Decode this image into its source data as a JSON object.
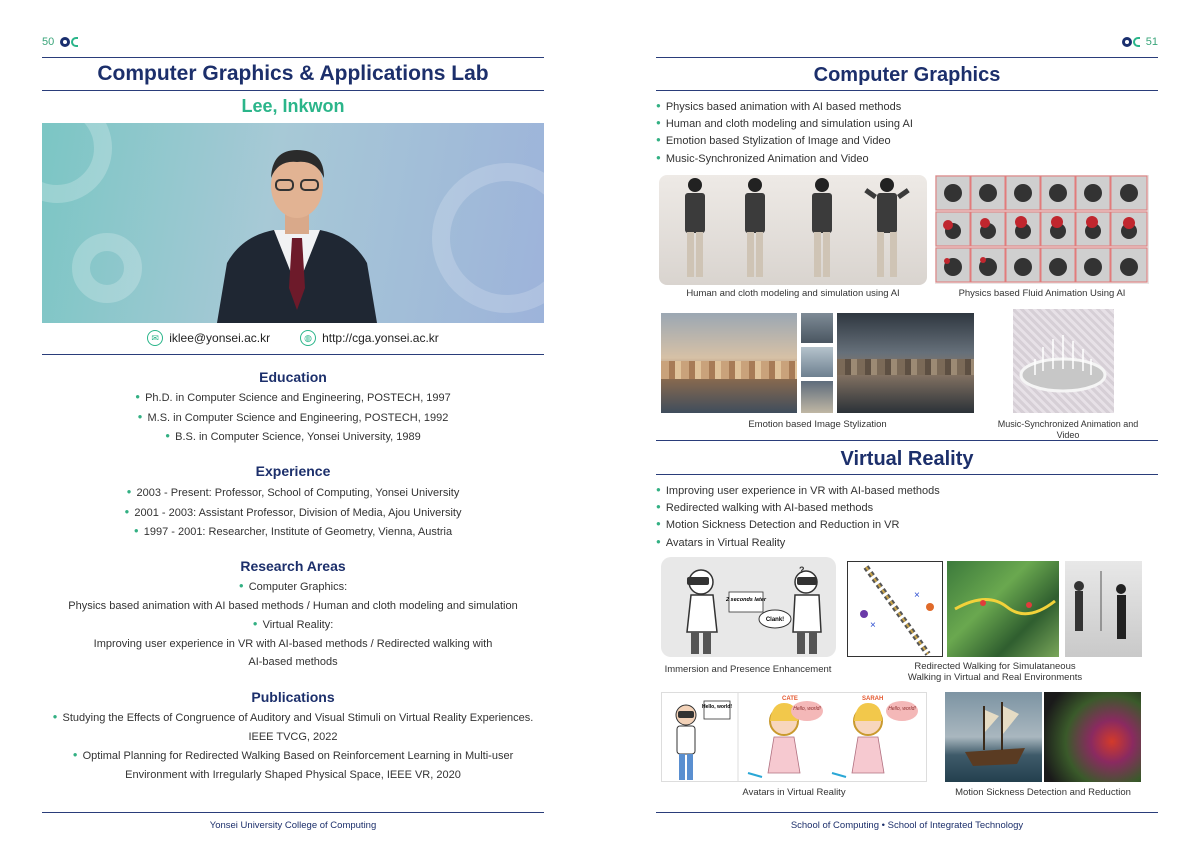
{
  "left": {
    "page_number": "50",
    "lab_title": "Computer Graphics & Applications Lab",
    "person_name": "Lee, Inkwon",
    "email": "iklee@yonsei.ac.kr",
    "website": "http://cga.yonsei.ac.kr",
    "education": {
      "heading": "Education",
      "items": [
        "Ph.D. in Computer Science and Engineering, POSTECH, 1997",
        "M.S. in Computer Science and Engineering, POSTECH, 1992",
        "B.S. in Computer Science, Yonsei University, 1989"
      ]
    },
    "experience": {
      "heading": "Experience",
      "items": [
        "2003 - Present: Professor, School of Computing, Yonsei University",
        "2001 - 2003: Assistant Professor, Division of Media, Ajou University",
        "1997 - 2001: Researcher, Institute of Geometry, Vienna, Austria"
      ]
    },
    "research": {
      "heading": "Research Areas",
      "cg_label": "Computer Graphics:",
      "cg_text": "Physics based animation with AI based methods / Human and cloth modeling and simulation",
      "vr_label": "Virtual Reality:",
      "vr_text1": "Improving user experience in VR with AI-based methods / Redirected walking with",
      "vr_text2": "AI-based methods"
    },
    "publications": {
      "heading": "Publications",
      "p1_line1": "Studying the Effects of Congruence of Auditory and Visual Stimuli on Virtual Reality Experiences.",
      "p1_line2": "IEEE TVCG, 2022",
      "p2_line1": "Optimal Planning for Redirected Walking Based on Reinforcement Learning in Multi-user",
      "p2_line2": "Environment with Irregularly Shaped Physical Space, IEEE VR, 2020"
    },
    "footer": "Yonsei University College of Computing"
  },
  "right": {
    "page_number": "51",
    "cg": {
      "heading": "Computer Graphics",
      "items": [
        "Physics based animation with AI based methods",
        "Human and cloth modeling and simulation using AI",
        "Emotion based Stylization of Image and Video",
        "Music-Synchronized Animation and Video"
      ],
      "captions": {
        "human_cloth": "Human and cloth modeling and simulation using AI",
        "fluid": "Physics based Fluid Animation Using AI",
        "stylization": "Emotion based Image Stylization",
        "music": "Music-Synchronized Animation and Video"
      }
    },
    "vr": {
      "heading": "Virtual Reality",
      "items": [
        "Improving user experience in VR with AI-based methods",
        "Redirected walking with AI-based methods",
        "Motion Sickness Detection and Reduction in VR",
        "Avatars in Virtual Reality"
      ],
      "captions": {
        "immersion": "Immersion and Presence Enhancement",
        "redirected1": "Redirected Walking for Simulataneous",
        "redirected2": "Walking in Virtual and Real Environments",
        "avatars": "Avatars in Virtual Reality",
        "motion": "Motion Sickness Detection and Reduction"
      },
      "comic": {
        "seconds_later": "2 seconds later",
        "clank": "Clank!",
        "cate": "CATE",
        "sarah": "SARAH",
        "hello": "Hello, world!"
      }
    },
    "footer": "School of Computing • School of Integrated Technology"
  }
}
